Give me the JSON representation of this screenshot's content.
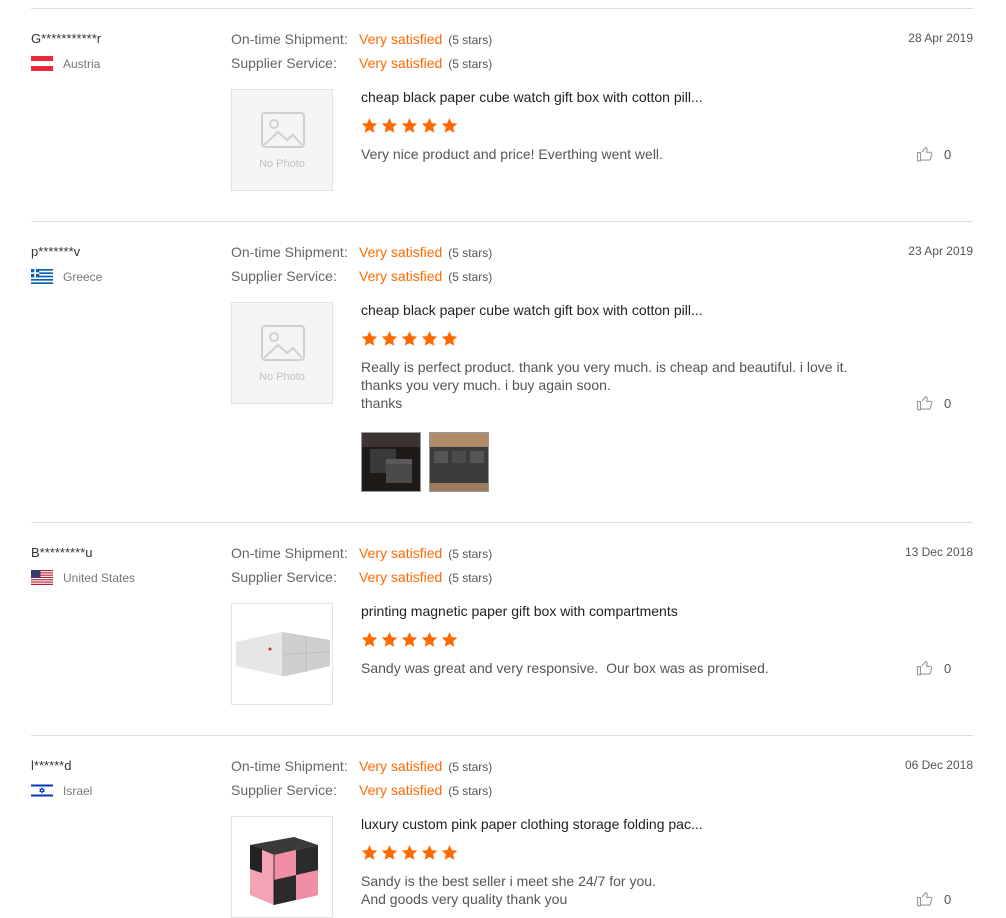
{
  "labels": {
    "shipment": "On-time Shipment:",
    "service": "Supplier Service:"
  },
  "colors": {
    "accent": "#ff6a00",
    "divider": "#dcdcdc"
  },
  "reviews": [
    {
      "name": "G***********r",
      "country": "Austria",
      "flag_icon": "austria-flag-icon",
      "date": "28 Apr 2019",
      "shipment_value": "Very satisfied",
      "shipment_stars": "(5 stars)",
      "service_value": "Very satisfied",
      "service_stars": "(5 stars)",
      "product_title": "cheap black paper cube watch gift box with cotton pill...",
      "product_image": "No Photo",
      "rating": 5,
      "text": [
        "Very nice product and price! Everthing went well."
      ],
      "likes": "0"
    },
    {
      "name": "p*******v",
      "country": "Greece",
      "flag_icon": "greece-flag-icon",
      "date": "23 Apr 2019",
      "shipment_value": "Very satisfied",
      "shipment_stars": "(5 stars)",
      "service_value": "Very satisfied",
      "service_stars": "(5 stars)",
      "product_title": "cheap black paper cube watch gift box with cotton pill...",
      "product_image": "No Photo",
      "rating": 5,
      "text": [
        "Really is perfect product. thank you very much. is cheap and beautiful. i love it.",
        "thanks you very much. i buy again soon.",
        "thanks"
      ],
      "likes": "0"
    },
    {
      "name": "B*********u",
      "country": "United States",
      "flag_icon": "usa-flag-icon",
      "date": "13 Dec 2018",
      "shipment_value": "Very satisfied",
      "shipment_stars": "(5 stars)",
      "service_value": "Very satisfied",
      "service_stars": "(5 stars)",
      "product_title": "printing magnetic paper gift box with compartments",
      "rating": 5,
      "text": [
        "Sandy was great and very responsive.  Our box was as promised."
      ],
      "likes": "0"
    },
    {
      "name": "l******d",
      "country": "Israel",
      "flag_icon": "israel-flag-icon",
      "date": "06 Dec 2018",
      "shipment_value": "Very satisfied",
      "shipment_stars": "(5 stars)",
      "service_value": "Very satisfied",
      "service_stars": "(5 stars)",
      "product_title": "luxury custom pink paper clothing storage folding pac...",
      "rating": 5,
      "text": [
        "Sandy is the best seller i meet she 24/7 for you.",
        "And goods very quality thank you"
      ],
      "likes": "0"
    }
  ]
}
